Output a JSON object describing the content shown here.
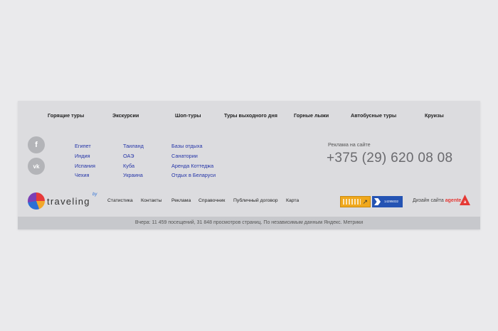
{
  "top_nav": [
    "Горящие туры",
    "Экскурсии",
    "Шоп-туры",
    "Туры выходного дня",
    "Горные лыжи",
    "Автобусные туры",
    "Круизы"
  ],
  "social": [
    {
      "icon": "facebook-icon",
      "glyph": "f"
    },
    {
      "icon": "vk-icon",
      "glyph": "vk"
    }
  ],
  "columns": [
    [
      "Египет",
      "Индия",
      "Испания",
      "Чехия"
    ],
    [
      "Таиланд",
      "ОАЭ",
      "Куба",
      "Украина"
    ],
    [
      "Базы отдыха",
      "Санатории",
      "Аренда Коттеджа",
      "Отдых в Беларуси"
    ]
  ],
  "ad": {
    "label": "Реклама на сайте",
    "phone": "+375 (29) 620 08 08"
  },
  "logo": {
    "text": "traveling",
    "sup": "by"
  },
  "bottom_nav": [
    "Статистика",
    "Контакты",
    "Реклама",
    "Справочник",
    "Публичный договор",
    "Карта"
  ],
  "badges": {
    "counter_number": "14295032"
  },
  "design_credit": {
    "prefix": "Дизайн сайта",
    "brand": "agente"
  },
  "stats": "Вчера: 11 459 посещений, 31 848 просмотров страниц. По независимым данным Яндекс. Метрики",
  "colors": {
    "link": "#2535a8",
    "footer_bg": "#dcdcdf",
    "stats_bg": "#c7c8cc",
    "accent_red": "#e53935"
  }
}
